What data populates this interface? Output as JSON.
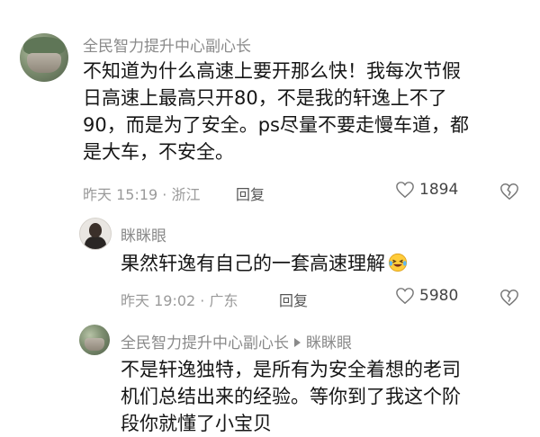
{
  "comments": [
    {
      "user": "全民智力提升中心副心长",
      "lines": [
        "不知道为什么高速上要开那么快！我每次节假",
        "日高速上最高只开80，不是我的轩逸上不了",
        "90，而是为了安全。ps尽量不要走慢车道，都",
        "是大车，不安全。"
      ],
      "time": "昨天 15:19",
      "location": "浙江",
      "reply_label": "回复",
      "likes": "1894"
    }
  ],
  "replies": [
    {
      "user": "眯眯眼",
      "text": "果然轩逸有自己的一套高速理解",
      "emoji": "laughing-crying-emoji",
      "time": "昨天 19:02",
      "location": "广东",
      "reply_label": "回复",
      "likes": "5980"
    },
    {
      "user": "全民智力提升中心副心长",
      "reply_to": "眯眯眼",
      "lines": [
        "不是轩逸独特，是所有为安全着想的老司",
        "机们总结出来的经验。等你到了我这个阶",
        "段你就懂了小宝贝"
      ]
    }
  ],
  "icons": {
    "like": "heart-outline-icon",
    "dislike": "broken-heart-icon",
    "reply_arrow": "triangle-right-icon"
  }
}
